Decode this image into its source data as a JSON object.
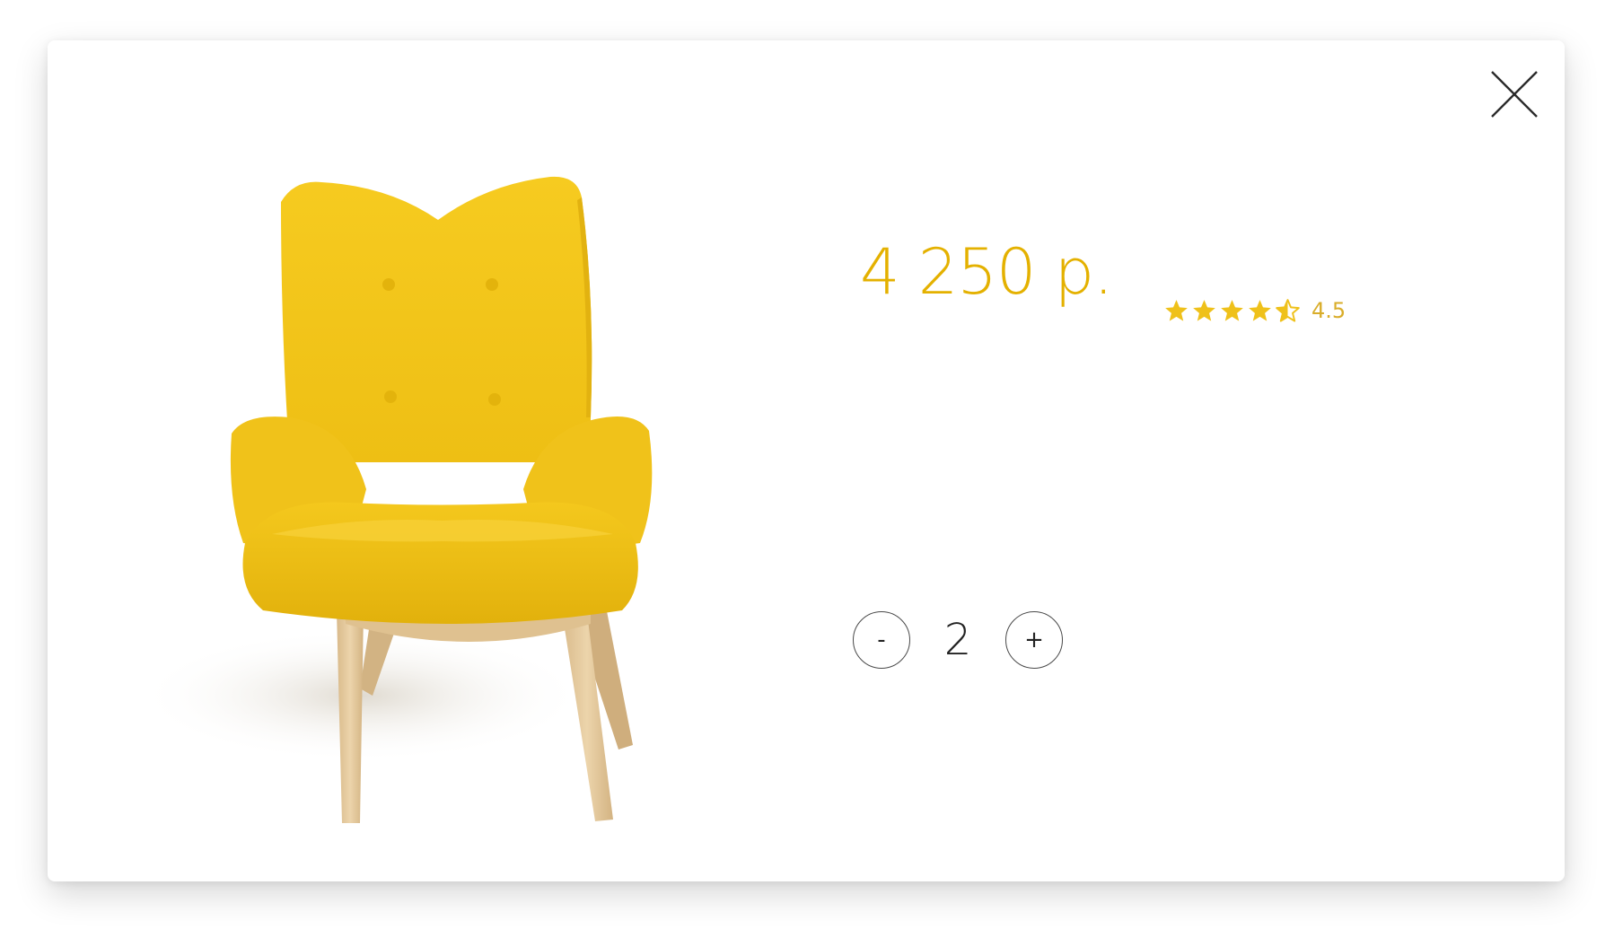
{
  "colors": {
    "accent": "#e4b100",
    "star": "#efc11a",
    "rating_text": "#d9ad2a",
    "chair_fabric": "#f4c81f",
    "chair_wood": "#e2c79c"
  },
  "product": {
    "image_alt": "yellow wingback armchair",
    "price": "4 250 р.",
    "rating": {
      "value": 4.5,
      "max": 5,
      "label": "4.5"
    }
  },
  "quantity": {
    "decrement_label": "-",
    "value": "2",
    "increment_label": "+"
  },
  "icons": {
    "close": "close-icon",
    "star": "star-icon",
    "half_star": "half-star-icon"
  }
}
